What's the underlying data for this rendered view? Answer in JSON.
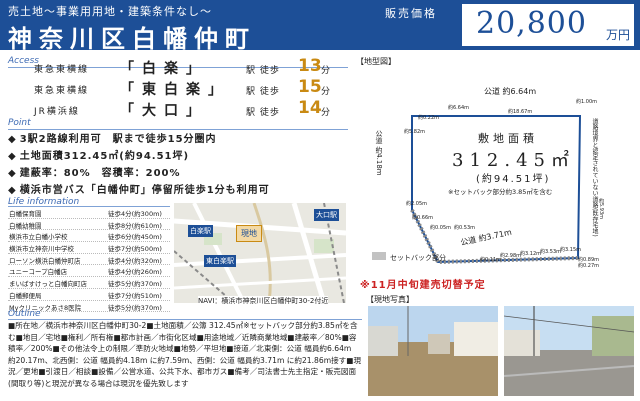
{
  "header": {
    "subtitle": "売土地～事業用用地・建築条件なし～",
    "title": "神奈川区白幡仲町",
    "price_label": "販売価格",
    "price": "20,800",
    "price_unit": "万円"
  },
  "access": {
    "label": "Access",
    "rows": [
      {
        "line": "東急東横線",
        "station": "「白楽」",
        "walk": "駅 徒歩",
        "minutes": "13",
        "unit": "分"
      },
      {
        "line": "東急東横線",
        "station": "「東白楽」",
        "walk": "駅 徒歩",
        "minutes": "15",
        "unit": "分"
      },
      {
        "line": "JR横浜線",
        "station": "「大口」",
        "walk": "駅 徒歩",
        "minutes": "14",
        "unit": "分"
      }
    ]
  },
  "points": {
    "label": "Point",
    "items": [
      "3駅2路線利用可　駅まで徒歩15分圏内",
      "土地面積312.45㎡(約94.51坪)",
      "建蔽率：80%　容積率：200%",
      "横浜市営バス「白幡仲町」停留所徒歩1分も利用可"
    ]
  },
  "life": {
    "label": "Life information",
    "items": [
      {
        "name": "白幡保育園",
        "dist": "徒歩4分(約300m)"
      },
      {
        "name": "白幡幼稚園",
        "dist": "徒歩8分(約610m)"
      },
      {
        "name": "横浜市立白幡小学校",
        "dist": "徒歩6分(約450m)"
      },
      {
        "name": "横浜市立神奈川中学校",
        "dist": "徒歩7分(約500m)"
      },
      {
        "name": "ローソン横浜白幡仲町店",
        "dist": "徒歩4分(約320m)"
      },
      {
        "name": "ユニーコープ白幡店",
        "dist": "徒歩4分(約260m)"
      },
      {
        "name": "まいばすけっと白幡向町店",
        "dist": "徒歩5分(約370m)"
      },
      {
        "name": "白幡郵便局",
        "dist": "徒歩7分(約510m)"
      },
      {
        "name": "Myクリニックあさ8医院",
        "dist": "徒歩5分(約370m)"
      }
    ]
  },
  "nav_map": {
    "nav_text": "NAVI：横浜市神奈川区白幡仲町30-2付近",
    "labels": [
      "白楽駅",
      "東白楽駅",
      "大口駅",
      "現地"
    ]
  },
  "outline": {
    "label": "Outline",
    "text": "■所在地／横浜市神奈川区白幡仲町30-2■土地面積／公簿 312.45㎡※セットバック部分約3.85㎡を含む■地目／宅地■権利／所有権■都市計画／市街化区域■用途地域／近隣商業地域■建蔽率／80%■容積率／200%■その他法令上の制限／準防火地域■地勢／平坦地■接道／北東側：公道 幅員約6.64m　約20.17m、北西側：公道 幅員約4.18m に約7.59m、西側：公道 幅員約3.71m に約21.86m接す■現況／更地■引渡日／相談■設備／公営水道、公共下水、都市ガス■備考／司法書士先主指定・販売図面(間取り等)と現況が異なる場合は現況を優先致します"
  },
  "plot": {
    "title": "【地型図】",
    "area_label": "敷地面積",
    "area_value": "312.45㎡",
    "area_tsubo": "(約94.51坪)",
    "setback_note": "※セットバック部分約3.85㎡を含む",
    "road_top": "公道 約6.64m",
    "road_left": "公道 約4.18m",
    "road_bottom": "公道 約3.71m",
    "road_right": "道路境界と認定されていない道路(既存宅地)",
    "legend": "セットバック部分",
    "dims": [
      "約18.67m",
      "約6.64m",
      "約0.22m",
      "約5.82m",
      "約2.05m",
      "約0.66m",
      "約0.05m",
      "約0.53m",
      "約0.11m",
      "約2.98m",
      "約3.12m",
      "約3.53m",
      "約3.12m",
      "約3.53m",
      "約3.15m",
      "約3.71m",
      "約0.89m",
      "約0.27m",
      "約5.93m",
      "約1.00m"
    ]
  },
  "notice": "※11月中旬建売切替予定",
  "photos": {
    "title": "【現地写真】"
  },
  "colors": {
    "brand": "#1d4f97",
    "accent": "#c98a13",
    "notice": "#cc2222"
  }
}
